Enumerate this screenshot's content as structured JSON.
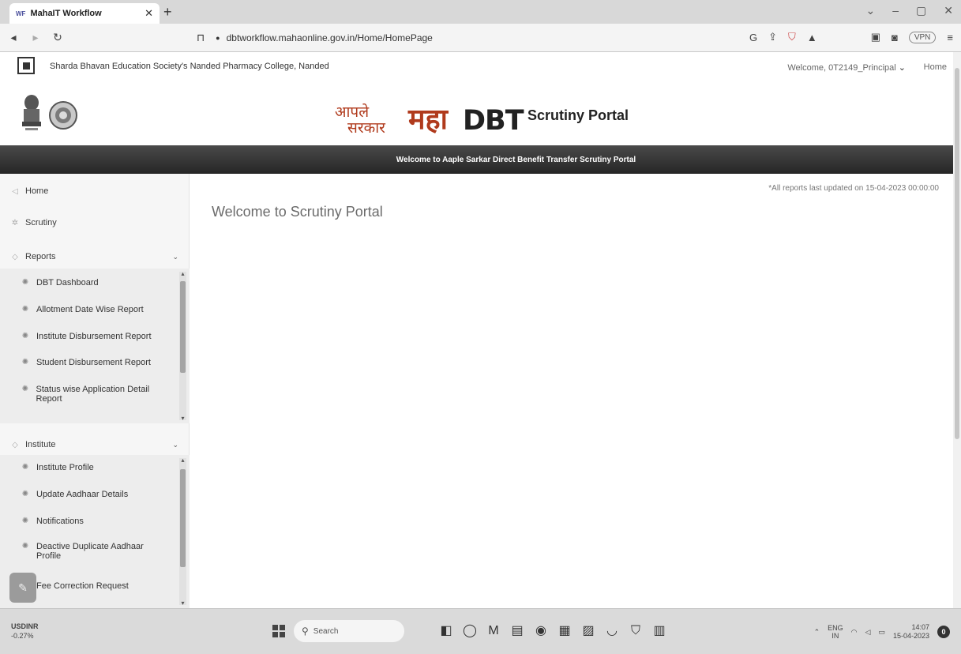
{
  "browser": {
    "tab_title": "MahaIT Workflow",
    "favicon_text": "WF",
    "url": "dbtworkflow.mahaonline.gov.in/Home/HomePage",
    "vpn_label": "VPN",
    "icons": [
      "back-icon",
      "forward-icon",
      "reload-icon",
      "bookmark-icon",
      "lock-icon",
      "share-icon",
      "brave-shield-icon",
      "rewards-icon",
      "sidebar-icon",
      "wallet-icon",
      "menu-icon"
    ]
  },
  "header": {
    "college_name": "Sharda Bhavan Education Society's Nanded Pharmacy College, Nanded",
    "welcome_user": "Welcome, 0T2149_Principal",
    "home_link": "Home",
    "logo_aaple": "आपले",
    "logo_sarkar": "सरकार",
    "logo_maha": "महा",
    "logo_dbt": "DBT",
    "portal_title": "Scrutiny Portal",
    "banner_text": "Welcome to Aaple Sarkar Direct Benefit Transfer Scrutiny Portal"
  },
  "sidebar": {
    "home": "Home",
    "scrutiny": "Scrutiny",
    "reports": {
      "label": "Reports",
      "items": [
        "DBT Dashboard",
        "Allotment Date Wise Report",
        "Institute Disbursement Report",
        "Student Disbursement Report",
        "Status wise Application Detail Report"
      ]
    },
    "institute": {
      "label": "Institute",
      "items": [
        "Institute Profile",
        "Update Aadhaar Details",
        "Notifications",
        "Deactive Duplicate Aadhaar Profile",
        "Fee Correction Request"
      ]
    }
  },
  "main": {
    "heading": "Welcome to Scrutiny Portal",
    "updated_note": "*All reports last updated on 15-04-2023 00:00:00"
  },
  "taskbar": {
    "weather_label": "USDINR",
    "weather_value": "-0.27%",
    "search_placeholder": "Search",
    "lang_top": "ENG",
    "lang_bottom": "IN",
    "time": "14:07",
    "date": "15-04-2023",
    "notification_count": "0"
  }
}
